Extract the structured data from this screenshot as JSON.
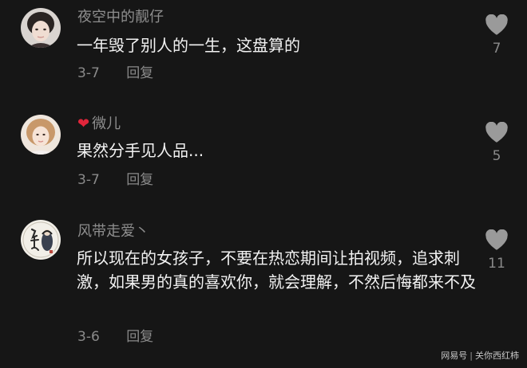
{
  "comments": [
    {
      "username": "夜空中的靓仔",
      "text": "一年毁了别人的一生，这盘算的",
      "date": "3-7",
      "reply_label": "回复",
      "likes": "7",
      "avatar_icon": "user-avatar-photo"
    },
    {
      "username_emoji": "❤️",
      "username": "微儿",
      "text": "果然分手见人品...",
      "date": "3-7",
      "reply_label": "回复",
      "likes": "5",
      "avatar_icon": "user-avatar-photo"
    },
    {
      "username": "风带走爱丶",
      "text": "所以现在的女孩子，不要在热恋期间让拍视频，追求刺激，如果男的真的喜欢你，就会理解，不然后悔都来不及",
      "date": "3-6",
      "reply_label": "回复",
      "likes": "11",
      "avatar_icon": "calligraphy-avatar"
    }
  ],
  "watermark": {
    "source": "网易号",
    "separator": "|",
    "author": "关你西红柿"
  },
  "colors": {
    "background": "#161616",
    "username": "#8e8e8e",
    "text": "#f2f2f2",
    "meta": "#8a8a8a",
    "like_icon": "#9a9a9a",
    "heart_emoji": "#e0253a"
  }
}
